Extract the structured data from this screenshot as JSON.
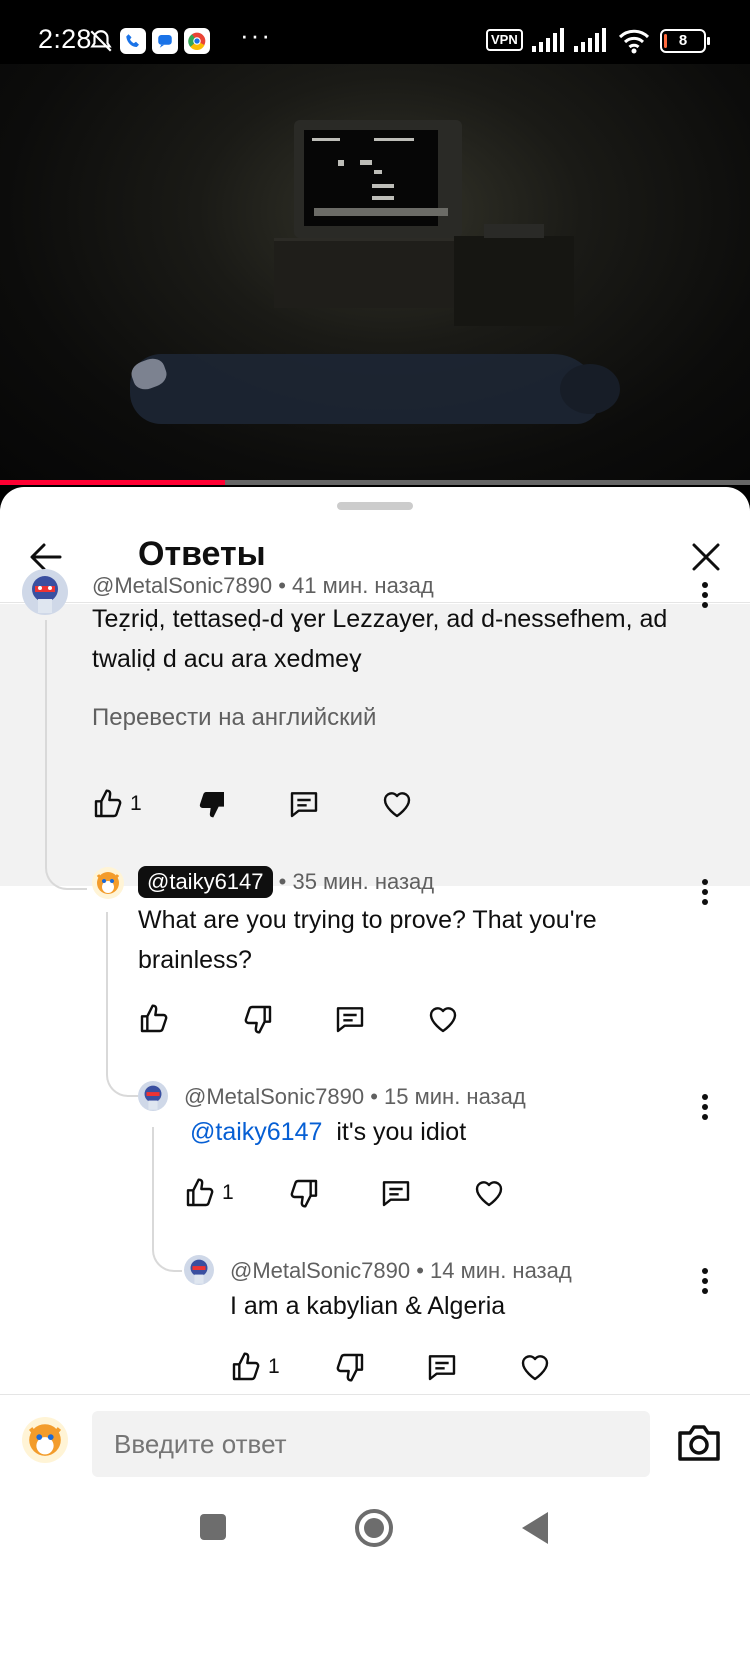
{
  "status_bar": {
    "time": "2:28",
    "icons": [
      "bell-muted-icon",
      "phone-app-icon",
      "messages-app-icon",
      "chrome-icon",
      "more-dots-icon",
      "vpn-icon",
      "signal-icon",
      "signal-icon",
      "wifi-icon",
      "battery-icon"
    ],
    "overflow": "···",
    "vpn_label": "VPN",
    "battery_level": "8",
    "battery_fraction": 0.08
  },
  "video": {
    "progress_fraction": 0.3
  },
  "sheet": {
    "title": "Ответы"
  },
  "comments": [
    {
      "handle": "@MetalSonic7890",
      "time": "• 41 мин. назад",
      "text": "Teẓriḍ, tettaseḍ-d ɣer Lezzayer, ad d-nessefhem, ad twaliḍ d acu ara xedmeɣ",
      "translate": "Перевести на английский",
      "likes": "1"
    },
    {
      "handle": "@taiky6147",
      "time": "• 35 мин. назад",
      "text": "What are you trying to prove? That you're brainless?",
      "likes": ""
    },
    {
      "handle": "@MetalSonic7890",
      "time": "• 15 мин. назад",
      "mention": "@taiky6147",
      "text": "it's you idiot",
      "likes": "1"
    },
    {
      "handle": "@MetalSonic7890",
      "time": "• 14 мин. назад",
      "text": "I am a kabylian & Algeria",
      "likes": "1"
    }
  ],
  "composer": {
    "placeholder": "Введите ответ"
  },
  "colors": {
    "accent": "#ff0033",
    "mention": "#065fd4",
    "highlight_bg": "#f2f2f2",
    "meta_text": "#606060"
  }
}
